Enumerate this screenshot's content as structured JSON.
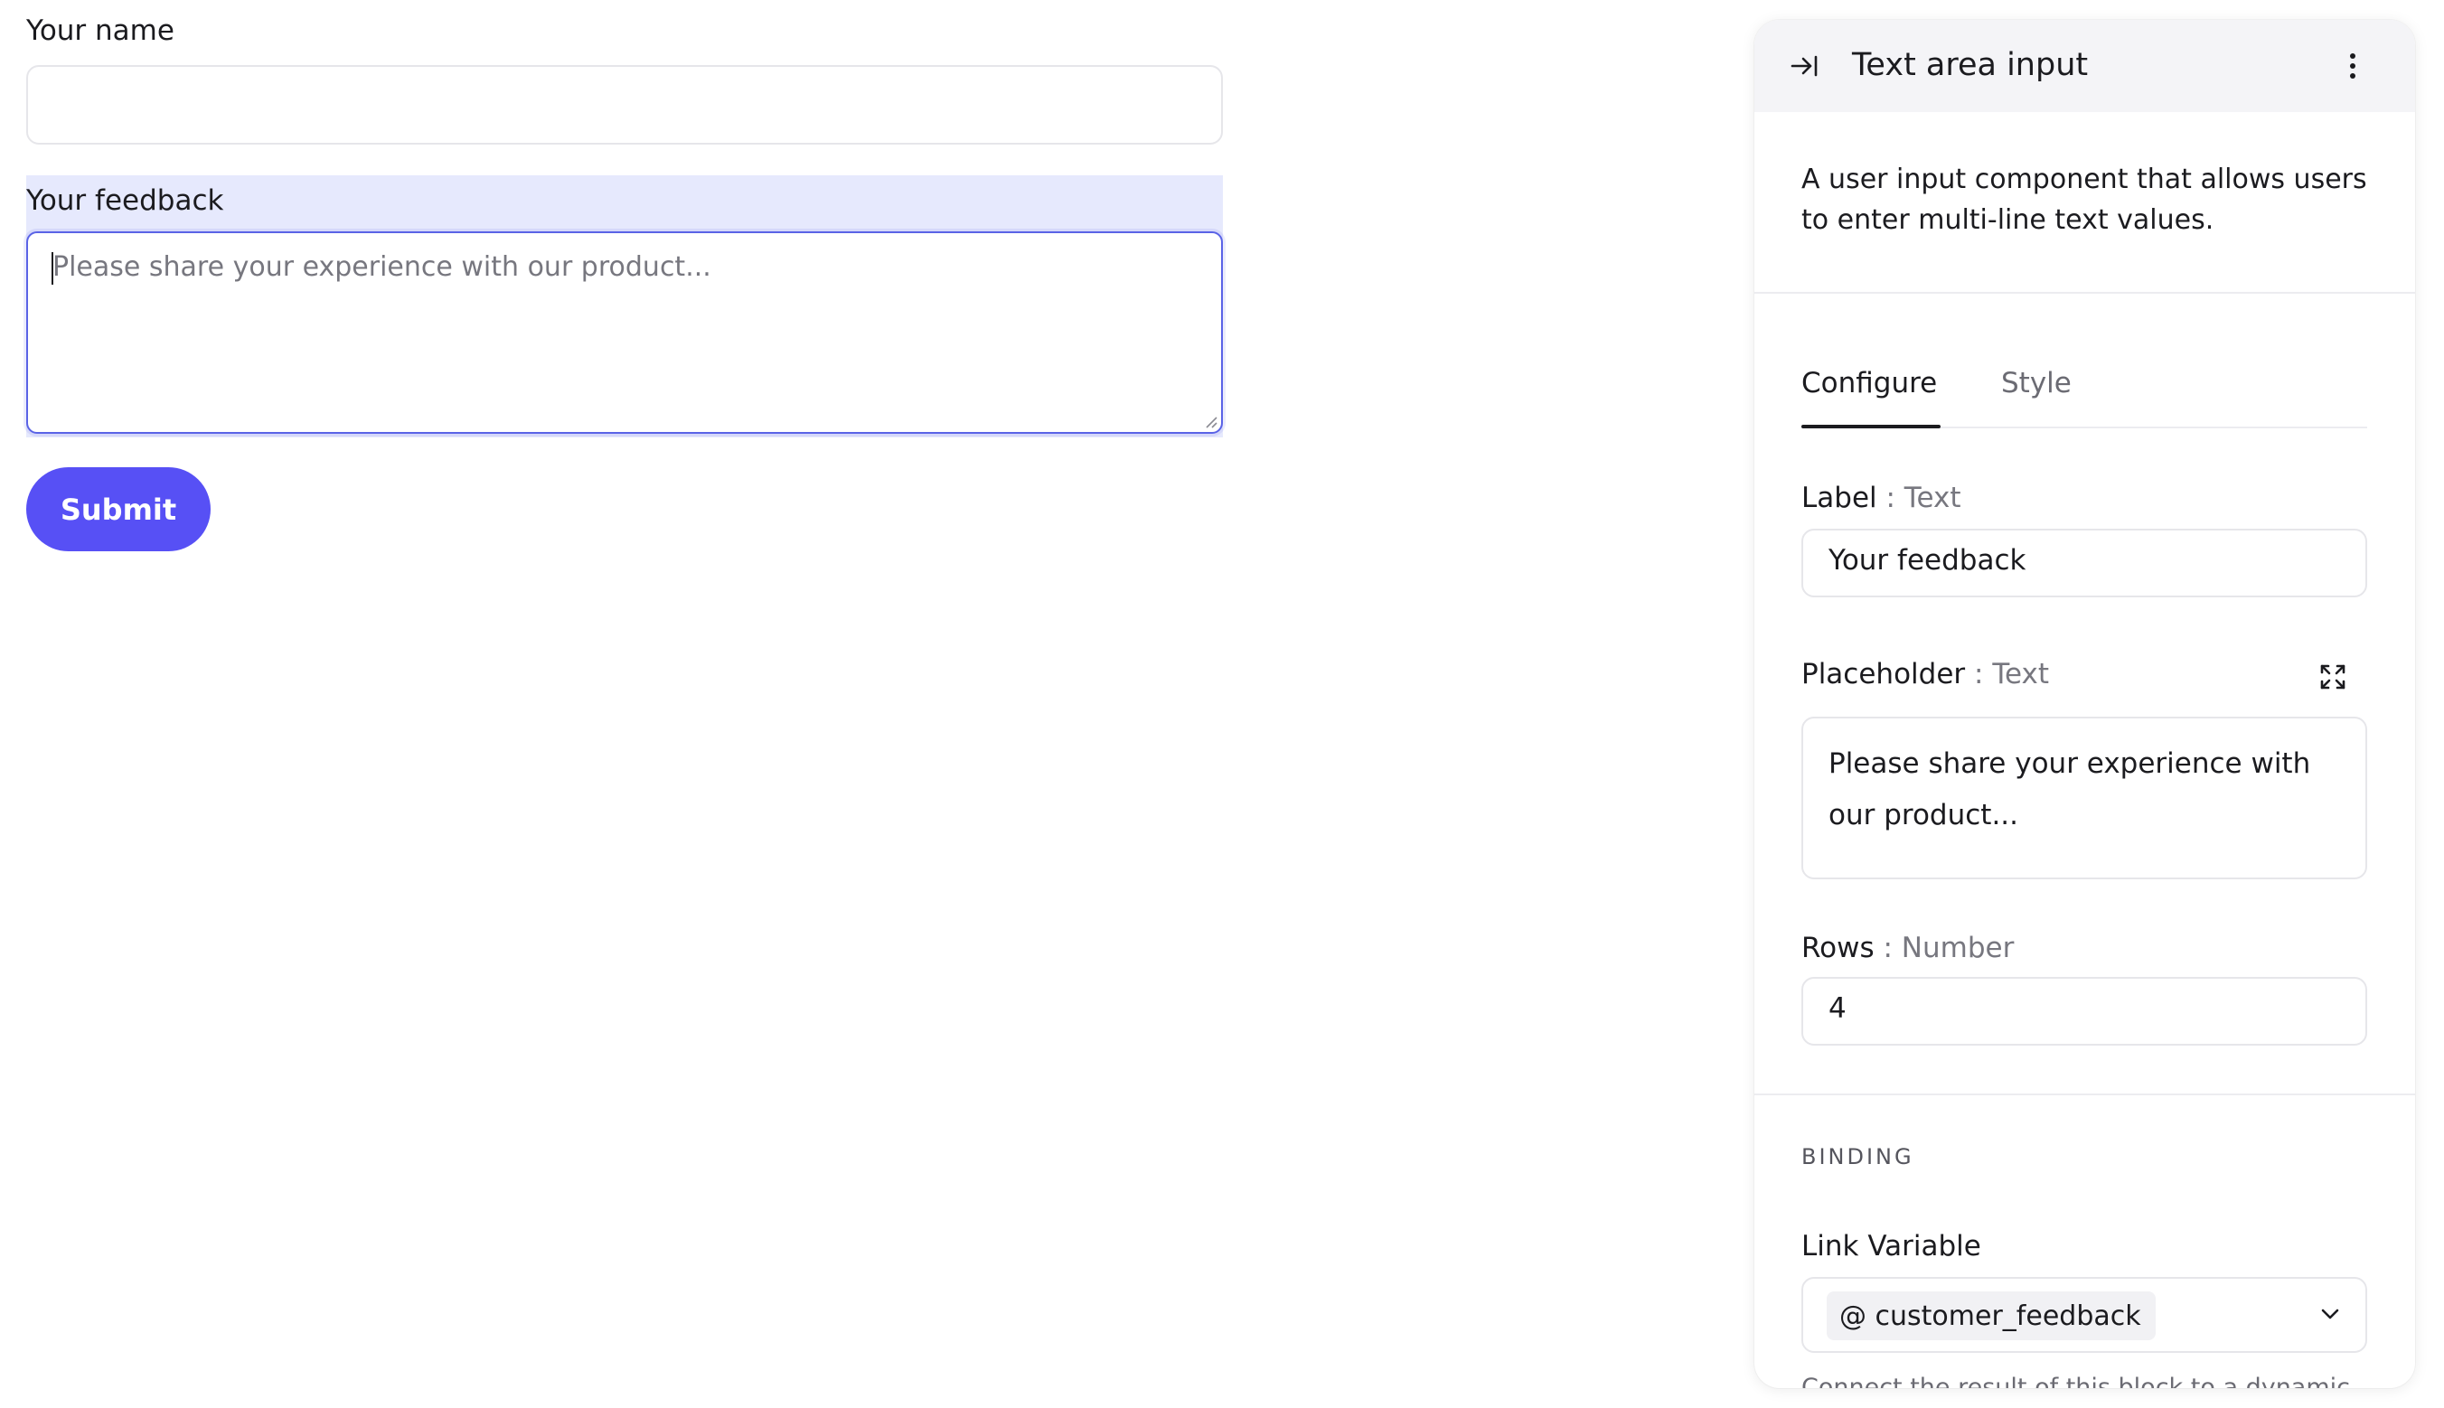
{
  "form": {
    "name_label": "Your name",
    "feedback_label": "Your feedback",
    "feedback_placeholder": "Please share your experience with our product...",
    "submit_label": "Submit"
  },
  "panel": {
    "title": "Text area input",
    "description": "A user input component that allows users to enter multi-line text values.",
    "tabs": [
      {
        "label": "Configure",
        "active": true
      },
      {
        "label": "Style",
        "active": false
      }
    ],
    "label_field": {
      "name": "Label",
      "type": ": Text",
      "value": "Your feedback"
    },
    "placeholder_field": {
      "name": "Placeholder",
      "type": ": Text",
      "line1": "Please share your experience with",
      "line2": "our product..."
    },
    "rows_field": {
      "name": "Rows",
      "type": ": Number",
      "value": "4"
    },
    "binding": {
      "heading": "BINDING",
      "link_label": "Link Variable",
      "variable": "@ customer_feedback",
      "help_text": "Connect the result of this block to a dynamic"
    }
  },
  "colors": {
    "accent": "#5750f5",
    "selection_highlight": "#e6e9fd",
    "focus_border": "#5a63e6"
  }
}
